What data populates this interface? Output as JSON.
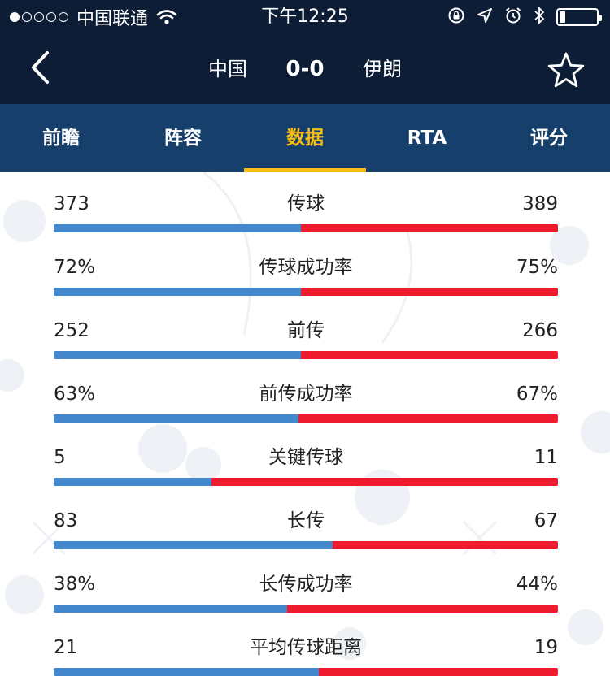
{
  "status_bar": {
    "carrier": "中国联通",
    "time": "下午12:25",
    "signal_bars": 1,
    "battery_level": 0.15
  },
  "header": {
    "home_team": "中国",
    "score": "0-0",
    "away_team": "伊朗"
  },
  "tabs": [
    {
      "label": "前瞻",
      "active": false
    },
    {
      "label": "阵容",
      "active": false
    },
    {
      "label": "数据",
      "active": true
    },
    {
      "label": "RTA",
      "active": false
    },
    {
      "label": "评分",
      "active": false
    }
  ],
  "stats": [
    {
      "name": "传球",
      "home": "373",
      "away": "389",
      "home_share": 0.49
    },
    {
      "name": "传球成功率",
      "home": "72%",
      "away": "75%",
      "home_share": 0.49
    },
    {
      "name": "前传",
      "home": "252",
      "away": "266",
      "home_share": 0.49
    },
    {
      "name": "前传成功率",
      "home": "63%",
      "away": "67%",
      "home_share": 0.485
    },
    {
      "name": "关键传球",
      "home": "5",
      "away": "11",
      "home_share": 0.313
    },
    {
      "name": "长传",
      "home": "83",
      "away": "67",
      "home_share": 0.553
    },
    {
      "name": "长传成功率",
      "home": "38%",
      "away": "44%",
      "home_share": 0.463
    },
    {
      "name": "平均传球距离",
      "home": "21",
      "away": "19",
      "home_share": 0.525
    }
  ],
  "colors": {
    "header_bg": "#0c1d35",
    "tab_bg": "#163f6b",
    "tab_active": "#f6bd15",
    "home_bar": "#4387cd",
    "away_bar": "#ee1b2e"
  },
  "icons": [
    "back-arrow-icon",
    "star-icon",
    "wifi-icon",
    "lock-rotation-icon",
    "location-icon",
    "alarm-icon",
    "bluetooth-icon",
    "battery-icon"
  ]
}
